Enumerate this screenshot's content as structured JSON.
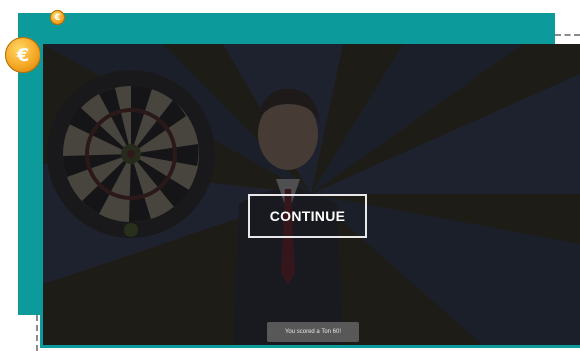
{
  "game": {
    "continue_label": "CONTINUE",
    "score_message": "You scored a Ton 60!",
    "overlay_color": "#141416",
    "frame_color": "#0c9a9a"
  },
  "coins": {
    "small_symbol": "€",
    "large_symbol": "€",
    "color": "#f5a623"
  }
}
